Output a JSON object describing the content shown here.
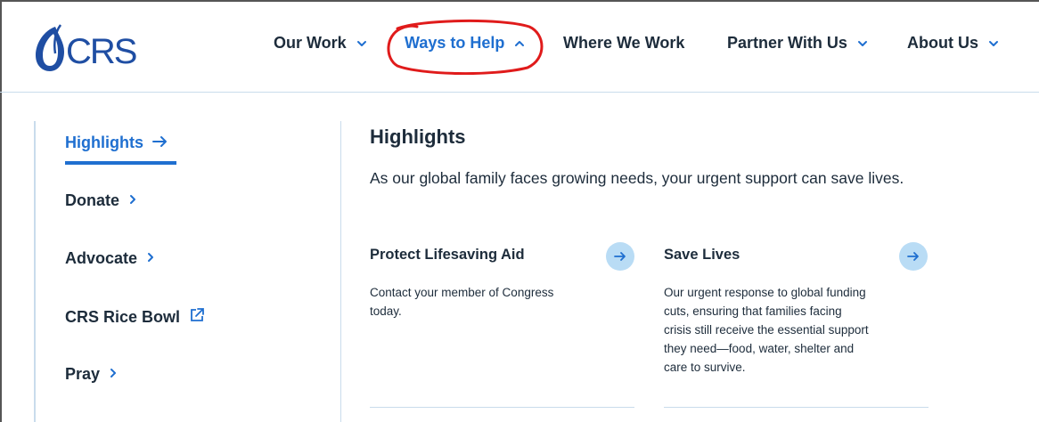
{
  "logo": {
    "text": "CRS"
  },
  "nav": [
    {
      "label": "Our Work",
      "has_dropdown": true,
      "expanded": false
    },
    {
      "label": "Ways to Help",
      "has_dropdown": true,
      "expanded": true
    },
    {
      "label": "Where We Work",
      "has_dropdown": false
    },
    {
      "label": "Partner With Us",
      "has_dropdown": true,
      "expanded": false
    },
    {
      "label": "About Us",
      "has_dropdown": true,
      "expanded": false
    }
  ],
  "sidebar": {
    "items": [
      {
        "label": "Highlights",
        "icon": "arrow-right-icon",
        "active": true
      },
      {
        "label": "Donate",
        "icon": "chevron-right-icon"
      },
      {
        "label": "Advocate",
        "icon": "chevron-right-icon"
      },
      {
        "label": "CRS Rice Bowl",
        "icon": "external-link-icon"
      },
      {
        "label": "Pray",
        "icon": "chevron-right-icon"
      }
    ]
  },
  "main": {
    "title": "Highlights",
    "subtitle": "As our global family faces growing needs, your urgent support can save lives.",
    "cards": [
      {
        "title": "Protect Lifesaving Aid",
        "lines": [
          "Contact your member of Congress",
          "today."
        ]
      },
      {
        "title": "Save Lives",
        "lines": [
          "Our urgent response to global funding",
          "cuts, ensuring that families facing",
          "crisis still receive the essential support",
          "they need—food, water, shelter and",
          "care to survive."
        ]
      }
    ]
  },
  "colors": {
    "accent": "#1f6fd0",
    "text": "#1d2c3b",
    "divider": "#c9dcec",
    "arrow_bg": "#b9dcf5",
    "annotation": "#e01b1b"
  }
}
